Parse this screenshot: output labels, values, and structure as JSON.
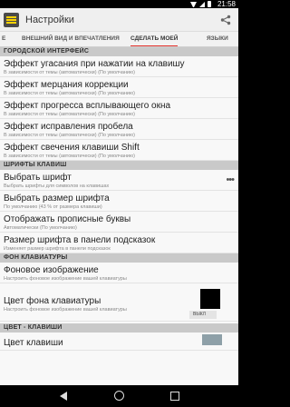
{
  "status_bar": {
    "time": "21:58"
  },
  "app_bar": {
    "title": "Настройки"
  },
  "tabs": [
    {
      "label": "Е"
    },
    {
      "label": "ВНЕШНИЙ ВИД И ВПЕЧАТЛЕНИЯ"
    },
    {
      "label": "СДЕЛАТЬ МОЕЙ"
    },
    {
      "label": "ЯЗЫКИ"
    }
  ],
  "sections": {
    "city": "ГОРОДСКОЙ ИНТЕРФЕЙС",
    "fonts": "ШРИФТЫ КЛАВИШ",
    "background": "ФОН КЛАВИАТУРЫ",
    "key_color": "ЦВЕТ - КЛАВИШИ"
  },
  "rows": {
    "fade": {
      "title": "Эффект угасания при нажатии на клавишу",
      "subtitle": "В зависимости от темы (автоматически) (По умолчанию)"
    },
    "flicker": {
      "title": "Эффект мерцания коррекции",
      "subtitle": "В зависимости от темы (автоматически) (По умолчанию)"
    },
    "popup": {
      "title": "Эффект прогресса всплывающего окна",
      "subtitle": "В зависимости от темы (автоматически) (По умолчанию)"
    },
    "space": {
      "title": "Эффект исправления пробела",
      "subtitle": "В зависимости от темы (автоматически) (По умолчанию)"
    },
    "shift": {
      "title": "Эффект свечения клавиши Shift",
      "subtitle": "В зависимости от темы (автоматически) (По умолчанию)"
    },
    "font": {
      "title": "Выбрать шрифт",
      "subtitle": "Выбрать шрифты для символов на клавишах"
    },
    "font_size": {
      "title": "Выбрать размер шрифта",
      "subtitle": "По умолчанию (43 % от размера клавиши)"
    },
    "caps": {
      "title": "Отображать прописные буквы",
      "subtitle": "Автоматически (По умолчанию)"
    },
    "hint_size": {
      "title": "Размер шрифта в панели подсказок",
      "subtitle": "Изменяет размер шрифта в панели подсказок"
    },
    "bg_image": {
      "title": "Фоновое изображение",
      "subtitle": "Настроить фоновое изображение вашей клавиатуры"
    },
    "bg_color": {
      "title": "Цвет фона клавиатуры",
      "subtitle": "Настроить фоновое изображение вашей клавиатуры",
      "toggle": "ВЫКЛ"
    },
    "key_row": {
      "title": "Цвет клавиши"
    }
  },
  "colors": {
    "accent": "#e4322c",
    "section_bg": "#c9c9c9",
    "swatch_black": "#000000",
    "swatch_grey": "#8ea0a8"
  }
}
